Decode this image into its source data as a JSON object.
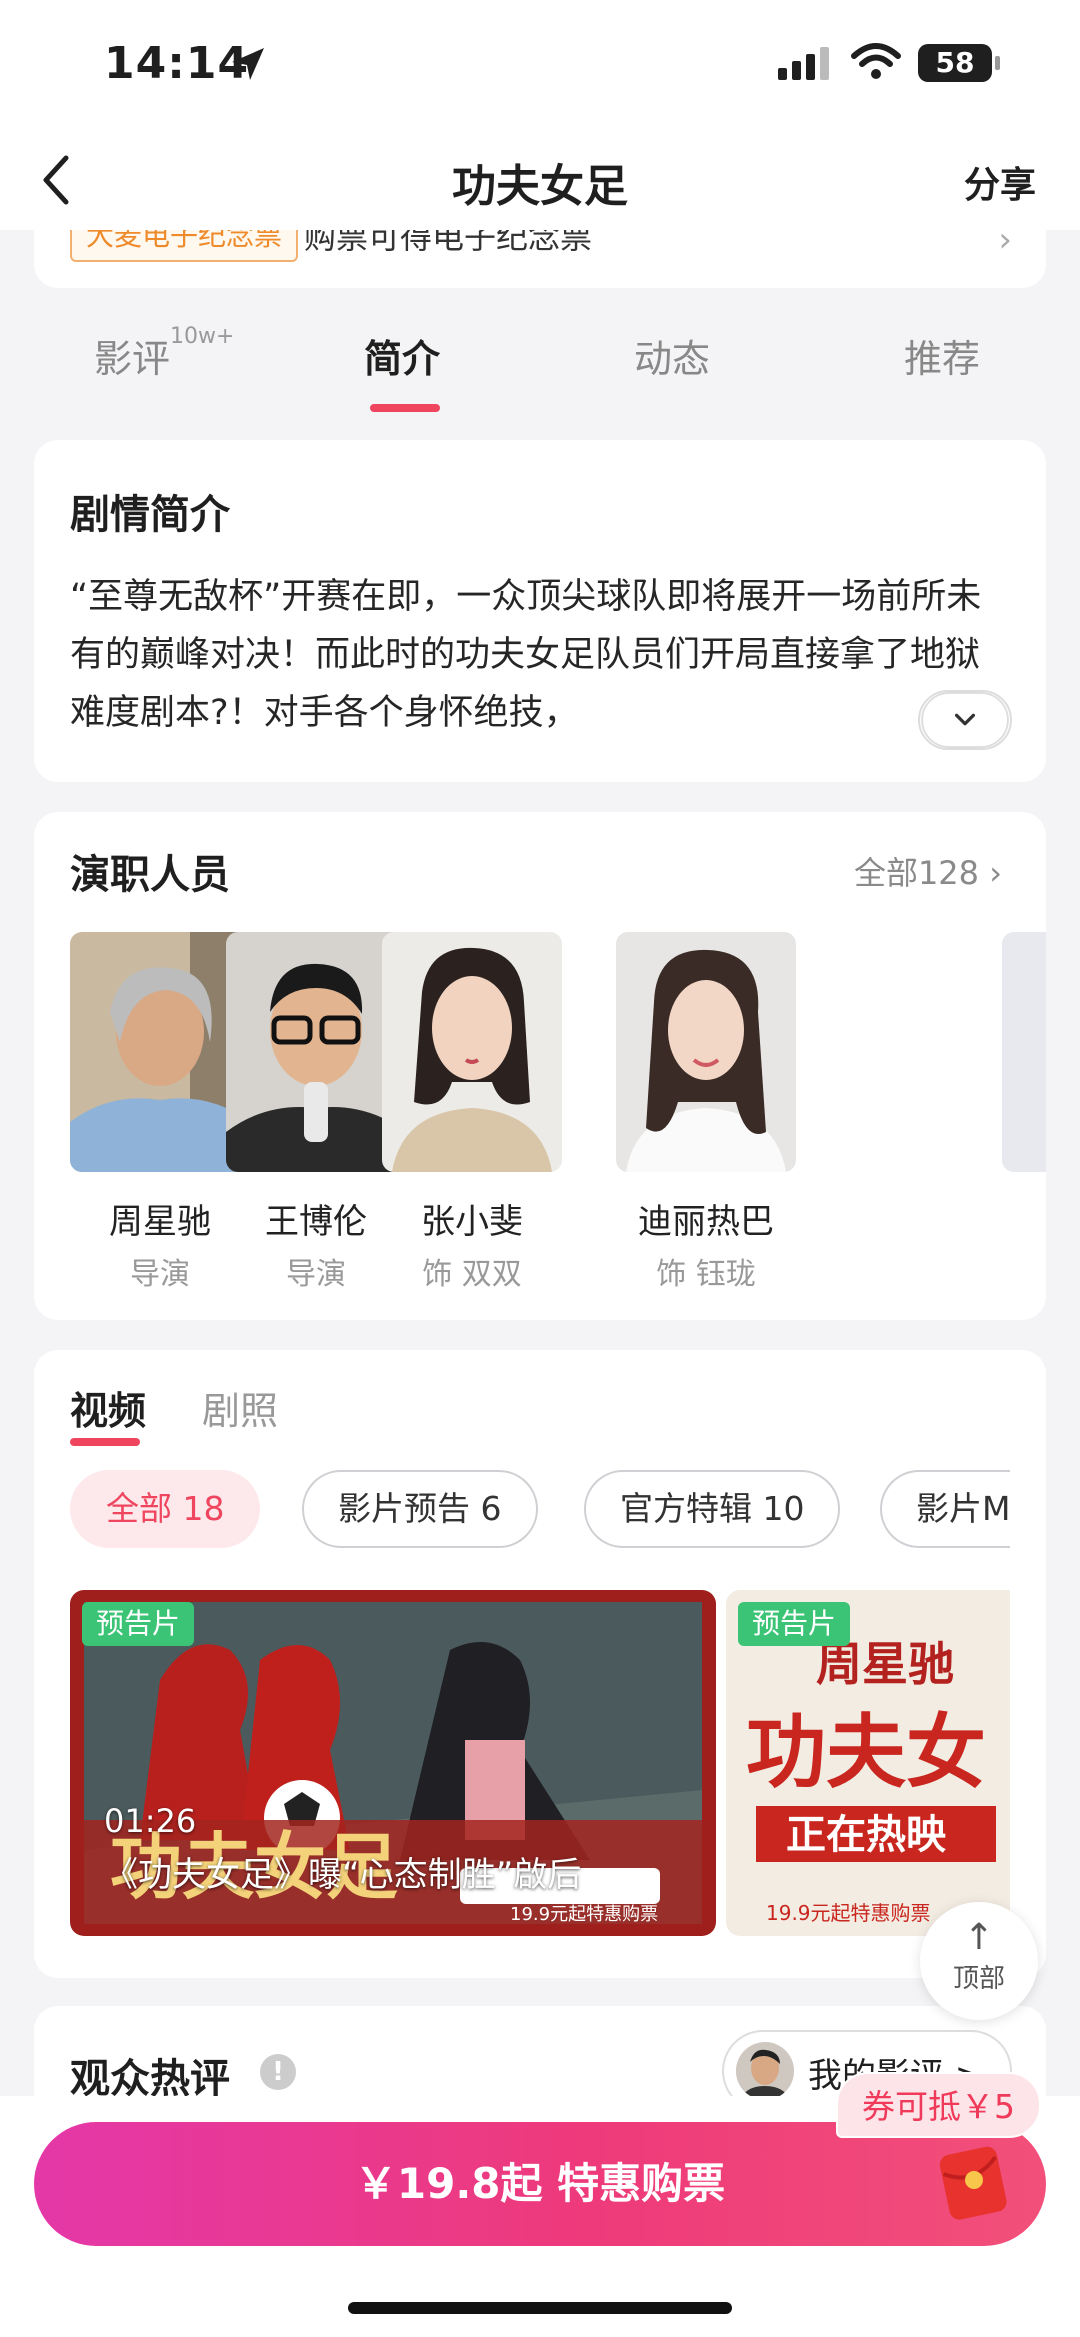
{
  "status_bar": {
    "time": "14:14",
    "battery": "58"
  },
  "nav": {
    "title": "功夫女足",
    "share": "分享"
  },
  "banner": {
    "tag": "大麦电子纪念票",
    "text": "购票可得电子纪念票"
  },
  "tabs": [
    {
      "label": "影评",
      "badge": "10w+"
    },
    {
      "label": "简介"
    },
    {
      "label": "动态"
    },
    {
      "label": "推荐"
    }
  ],
  "active_tab": "简介",
  "synopsis": {
    "title": "剧情简介",
    "body": "“至尊无敌杯”开赛在即，一众顶尖球队即将展开一场前所未有的巅峰对决！而此时的功夫女足队员们开局直接拿了地狱难度剧本?！对手各个身怀绝技，"
  },
  "cast": {
    "title": "演职人员",
    "all_label": "全部128",
    "people": [
      {
        "name": "周星驰",
        "role": "导演"
      },
      {
        "name": "王博伦",
        "role": "导演"
      },
      {
        "name": "张小斐",
        "role": "饰 双双"
      },
      {
        "name": "迪丽热巴",
        "role": "饰 钰珑"
      }
    ]
  },
  "media": {
    "tabs": [
      "视频",
      "剧照"
    ],
    "filters": [
      "全部 18",
      "影片预告 6",
      "官方特辑 10",
      "影片MV"
    ],
    "videos": [
      {
        "badge": "预告片",
        "duration": "01:26",
        "title": "《功夫女足》曝“心态制胜”啟后"
      },
      {
        "badge": "预告片"
      }
    ]
  },
  "reviews": {
    "title": "观众热评",
    "info_icon": "!",
    "my_review": "我的影评 >"
  },
  "back_to_top": {
    "arrow": "↑",
    "label": "顶部"
  },
  "buy": {
    "label": "￥19.8起 特惠购票",
    "coupon": "券可抵￥5"
  },
  "colors": {
    "accent": "#f0455e",
    "buy_gradient_start": "#e438a8",
    "buy_gradient_end": "#f2507a",
    "badge_green": "#3cc476"
  }
}
